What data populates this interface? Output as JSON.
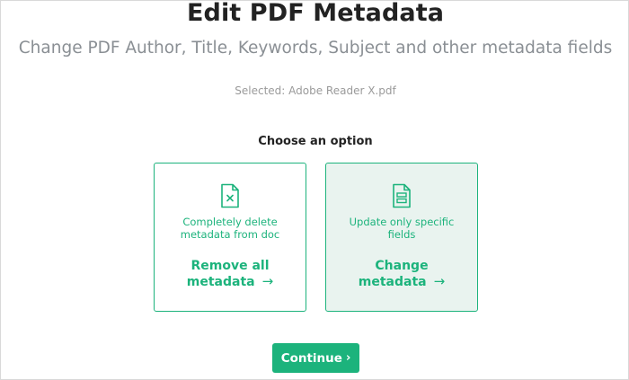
{
  "header": {
    "title": "Edit PDF Metadata",
    "subtitle": "Change PDF Author, Title, Keywords, Subject and other metadata fields",
    "selected_file": "Selected: Adobe Reader X.pdf"
  },
  "options": {
    "heading": "Choose an option",
    "items": [
      {
        "description_line1": "Completely delete",
        "description_line2": "metadata from doc",
        "action_line1": "Remove all",
        "action_line2": "metadata",
        "icon": "file-x-icon",
        "selected": false
      },
      {
        "description_line1": "Update only specific",
        "description_line2": "fields",
        "action_line1": "Change",
        "action_line2": "metadata",
        "icon": "form-document-icon",
        "selected": true
      }
    ],
    "arrow_glyph": "→"
  },
  "footer": {
    "continue_label": "Continue",
    "continue_glyph": "›"
  },
  "colors": {
    "accent": "#1cb37c",
    "selected_card_bg": "#e9f3ef",
    "title": "#222222",
    "subtitle": "#8a8f94"
  }
}
